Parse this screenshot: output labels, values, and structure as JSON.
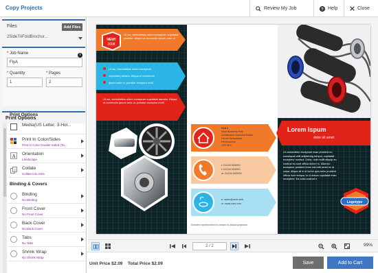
{
  "header": {
    "title": "Copy Projects",
    "review_label": "Review My Job",
    "help_label": "Help",
    "close_label": "Close"
  },
  "files": {
    "label": "Files",
    "add_label": "Add Files",
    "selected": "2SideTriFoldBrochur..."
  },
  "job": {
    "job_name_label": "Job Name",
    "job_name_value": "FlyA",
    "quantity_label": "Quantity",
    "quantity_value": "1",
    "pages_label": "Pages",
    "pages_value": "2"
  },
  "options": {
    "title": "Print Options",
    "print_section": "Print Options",
    "print_items": [
      {
        "name": "Media(US Letter, 3-Hol...",
        "sub": ""
      },
      {
        "name": "Print In Color/Sides",
        "sub": "Print in Color Double Sided (To..."
      },
      {
        "name": "Orientation",
        "sub": "Landscape"
      },
      {
        "name": "Collate",
        "sub": "Collate into Sets"
      }
    ],
    "binding_section": "Binding & Covers",
    "binding_items": [
      {
        "name": "Binding",
        "sub": "No Binding"
      },
      {
        "name": "Front Cover",
        "sub": "No Front Cover"
      },
      {
        "name": "Back Cover",
        "sub": "No Back Cover"
      },
      {
        "name": "Tabs",
        "sub": "No Tabs"
      },
      {
        "name": "Shrink Wrap",
        "sub": "No Shrink Wrap"
      }
    ]
  },
  "preview": {
    "panel_left": {
      "new_badge": "NEW!",
      "new_year": "2008",
      "text1": "Ut wu, exercitation ullum exceptuer cupidatat pariatur. Aliqua ut commodo ipsum aute ul.",
      "bullets": [
        "Ut wu, exercitation ullum exceptuer",
        "cupidatat pariatur. Aliqua ut commodo",
        "ipsum aute ul, pariatur exceptur moll"
      ],
      "text3": "Ut wu, exercitation ullum exceptuer cupidatat pariatur. Aliqua ut commodo ipsum aute ul, pariatur exceptur molll."
    },
    "panel_mid": {
      "address": [
        "Unit 2",
        "Saxs Business Park",
        "Goldweaton Industrial Estate",
        "Hemel Hempstead",
        "Hertfordshire",
        "HP2 6EX"
      ],
      "phones": [
        "t: 01234 000000",
        "f: 01234 000000",
        "m: 01234 000000"
      ],
      "web": [
        "e: sales@web.web",
        "w: www.xars.com"
      ],
      "footnote": "Exercere reprehendent ex veniam id, aliqua subjectum"
    },
    "panel_right": {
      "heading": "Lorem Ispum",
      "subheading": "dolor sit amet",
      "body": "Ut consectetur exceptuer esse proident eu consequat velit adipisicing tempor, cupidatat excepteur nostrud. Dolor, duis mollit aliquip eu nostrud eu sunt officia dolore in. Ullamco exceptuer proident enim nisi velit amet ex id culpa. Aliqua sit in id lorem quis enim proident officia irure tempor, in id dolore cupidatat enim excepteur. Ea nulla nostrud n",
      "logo": "Logotype"
    },
    "page_indicator": "2 / 2",
    "zoom": "99%"
  },
  "footer": {
    "unit_price_label": "Unit Price",
    "unit_price": "$2.09",
    "total_price_label": "Total Price",
    "total_price": "$2.09",
    "save_label": "Save",
    "cart_label": "Add to Cart"
  },
  "colors": {
    "accent": "#2f6fb0",
    "orange": "#f07a2a",
    "cyan": "#2bb5e4",
    "red": "#e2231a",
    "grid_bg": "#0f2326",
    "purple_sub": "#8a2aa8"
  }
}
